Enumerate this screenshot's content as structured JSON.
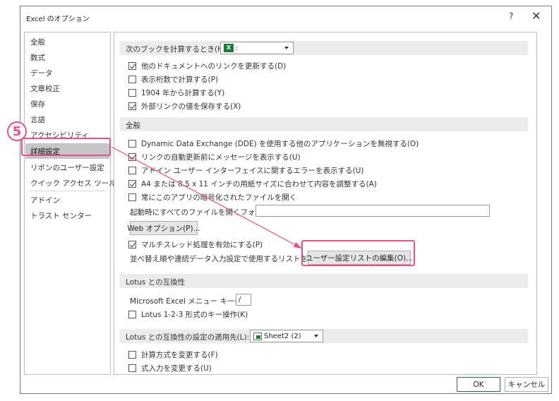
{
  "window": {
    "title": "Excel のオプション",
    "help": "?",
    "close": "✕"
  },
  "sidebar": {
    "items": [
      {
        "label": "全般"
      },
      {
        "label": "数式"
      },
      {
        "label": "データ"
      },
      {
        "label": "文章校正"
      },
      {
        "label": "保存"
      },
      {
        "label": "言語"
      },
      {
        "label": "アクセシビリティ"
      },
      {
        "label": "詳細設定",
        "selected": true
      },
      {
        "label": "リボンのユーザー設定"
      },
      {
        "label": "クイック アクセス ツール バー"
      },
      {
        "label": "アドイン"
      },
      {
        "label": "トラスト センター"
      }
    ]
  },
  "content": {
    "calc_book": {
      "label": "次のブックを計算するとき(H):",
      "select_value": ":",
      "options": [
        {
          "label": "他のドキュメントへのリンクを更新する(D)",
          "checked": true
        },
        {
          "label": "表示桁数で計算する(P)",
          "checked": false
        },
        {
          "label": "1904 年から計算する(Y)",
          "checked": false
        },
        {
          "label": "外部リンクの値を保存する(X)",
          "checked": true
        }
      ]
    },
    "general": {
      "label": "全般",
      "options": [
        {
          "label": "Dynamic Data Exchange (DDE) を使用する他のアプリケーションを無視する(O)",
          "checked": false
        },
        {
          "label": "リンクの自動更新前にメッセージを表示する(U)",
          "checked": true
        },
        {
          "label": "アドイン ユーザー インターフェイスに関するエラーを表示する(U)",
          "checked": false
        },
        {
          "label": "A4 または 8.5 x 11 インチの用紙サイズに合わせて内容を調整する(A)",
          "checked": true
        },
        {
          "label": "常にこのアプリの暗号化されたファイルを開く",
          "checked": false
        }
      ],
      "startup_folder_label": "起動時にすべてのファイルを開くフォルダー(L):",
      "startup_folder_value": "",
      "web_options_button": "Web オプション(P)...",
      "multithread": {
        "label": "マルチスレッド処理を有効にする(P)",
        "checked": true
      },
      "custom_lists_label": "並べ替え順や連続データ入力設定で使用するリストを作成します:",
      "custom_lists_button": "ユーザー設定リストの編集(O)..."
    },
    "lotus_compat": {
      "label": "Lotus との互換性",
      "menu_key_label": "Microsoft Excel メニュー キー(M):",
      "menu_key_value": "/",
      "lotus_keys": {
        "label": "Lotus 1-2-3 形式のキー操作(K)",
        "checked": false
      }
    },
    "lotus_settings": {
      "label": "Lotus との互換性の設定の適用先(L):",
      "select_value": "Sheet2 (2)",
      "options": [
        {
          "label": "計算方式を変更する(F)",
          "checked": false
        },
        {
          "label": "式入力を変更する(U)",
          "checked": false
        }
      ]
    }
  },
  "footer": {
    "ok": "OK",
    "cancel": "キャンセル"
  },
  "annotation": {
    "step": "5",
    "color": "#e24f8a"
  },
  "colors": {
    "accent_green": "#217346",
    "highlight_pink": "#e24f8a",
    "selected_bg": "#c6c6c6"
  }
}
